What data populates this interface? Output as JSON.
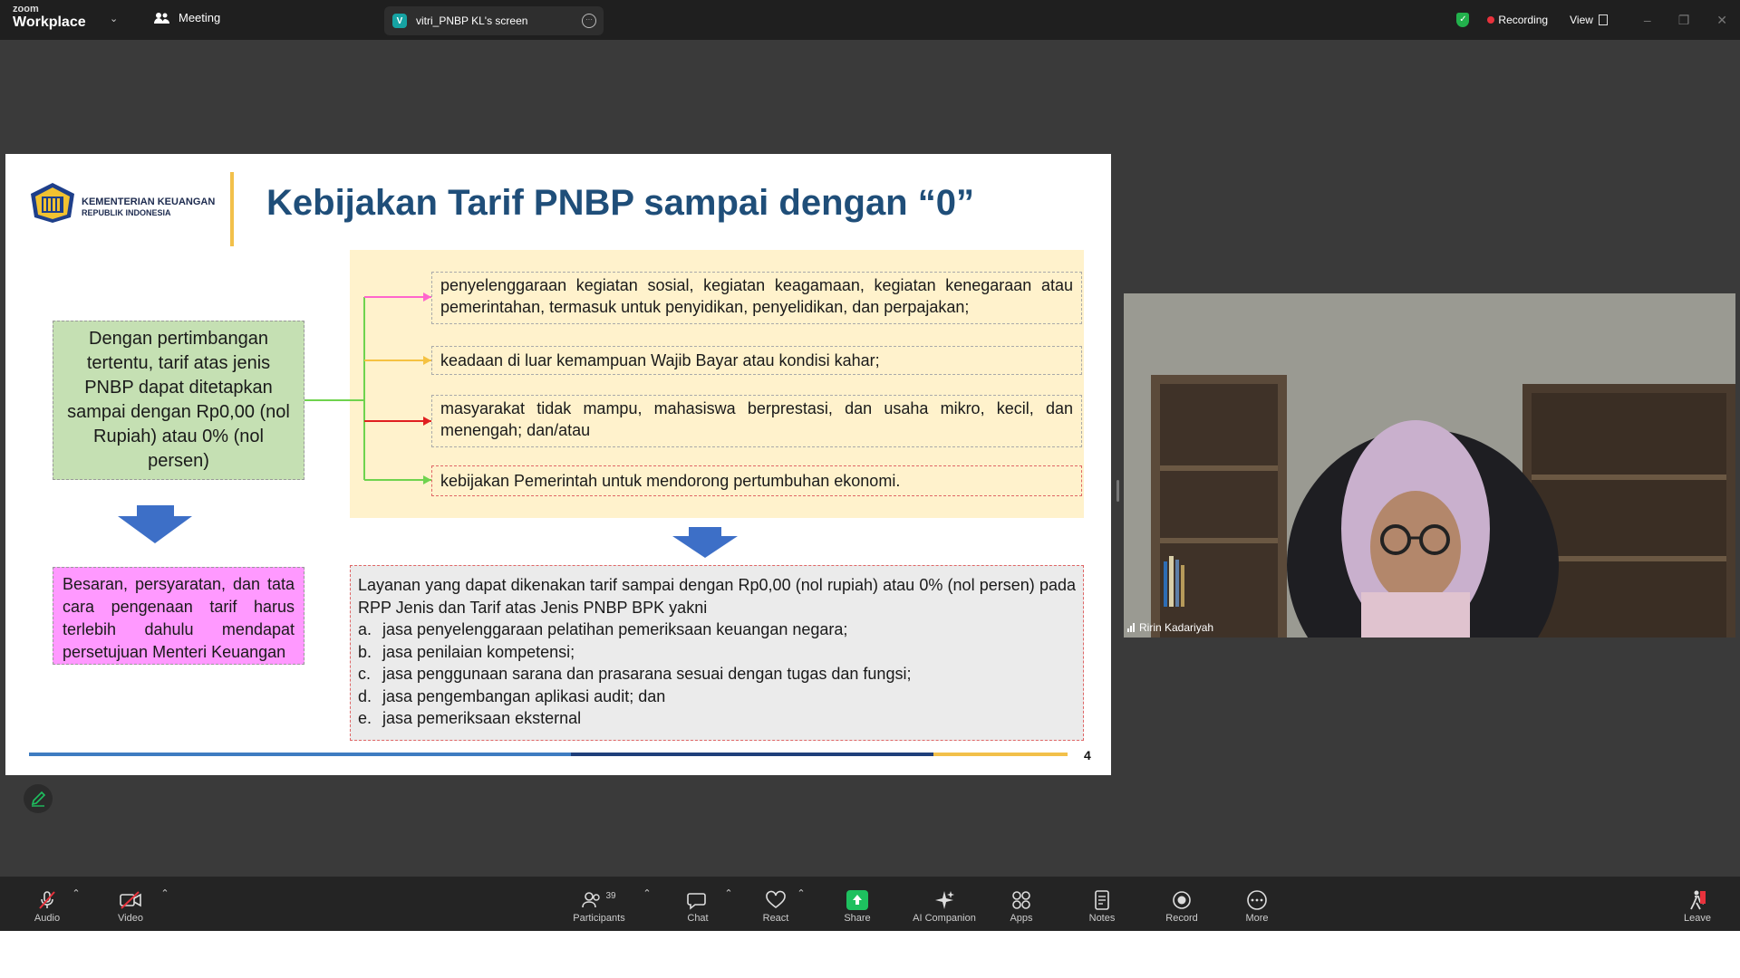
{
  "app": {
    "logo_top": "zoom",
    "logo_bottom": "Workplace",
    "meeting_tab": "Meeting",
    "share_tab": {
      "initial": "V",
      "label": "vitri_PNBP KL's screen"
    },
    "recording_label": "Recording",
    "view_label": "View"
  },
  "slide": {
    "ministry_name": "KEMENTERIAN KEUANGAN",
    "ministry_sub": "REPUBLIK INDONESIA",
    "title": "Kebijakan Tarif PNBP sampai dengan “0”",
    "left_box": "Dengan pertimbangan tertentu, tarif atas jenis PNBP dapat ditetapkan sampai dengan Rp0,00 (nol Rupiah) atau 0% (nol persen)",
    "left_bottom_box": "Besaran, persyaratan, dan tata cara pengenaan tarif harus terlebih dahulu mendapat persetujuan Menteri Keuangan",
    "items": [
      "penyelenggaraan kegiatan sosial, kegiatan keagamaan, kegiatan kenegaraan atau pemerintahan, termasuk untuk penyidikan, penyelidikan, dan perpajakan;",
      "keadaan di luar kemampuan Wajib Bayar atau kondisi kahar;",
      "masyarakat tidak mampu, mahasiswa berprestasi, dan usaha mikro, kecil, dan menengah; dan/atau",
      "kebijakan Pemerintah untuk mendorong pertumbuhan ekonomi."
    ],
    "services_intro": "Layanan yang dapat dikenakan tarif sampai dengan Rp0,00 (nol rupiah) atau 0% (nol persen) pada RPP Jenis dan Tarif atas Jenis PNBP BPK yakni",
    "services": [
      {
        "letter": "a.",
        "text": "jasa penyelenggaraan pelatihan pemeriksaan keuangan negara;"
      },
      {
        "letter": "b.",
        "text": "jasa penilaian kompetensi;"
      },
      {
        "letter": "c.",
        "text": "jasa penggunaan sarana dan prasarana sesuai dengan tugas dan fungsi;"
      },
      {
        "letter": "d.",
        "text": "jasa pengembangan aplikasi audit; dan"
      },
      {
        "letter": "e.",
        "text": "jasa pemeriksaan eksternal"
      }
    ],
    "page_number": "4"
  },
  "video": {
    "participant_name": "Ririn Kadariyah"
  },
  "toolbar": {
    "audio": "Audio",
    "video": "Video",
    "participants": "Participants",
    "participant_count": "39",
    "chat": "Chat",
    "react": "React",
    "share": "Share",
    "ai_companion": "AI Companion",
    "apps": "Apps",
    "notes": "Notes",
    "record": "Record",
    "more": "More",
    "leave": "Leave"
  },
  "colors": {
    "title_blue": "#1f4e79",
    "green_box": "#c5e0b3",
    "pink_box": "#ff99ff",
    "yellow_panel": "#fff2cc",
    "arrow_blue": "#3d6fc7",
    "share_green": "#1ec05f",
    "recording_red": "#e8323c"
  }
}
